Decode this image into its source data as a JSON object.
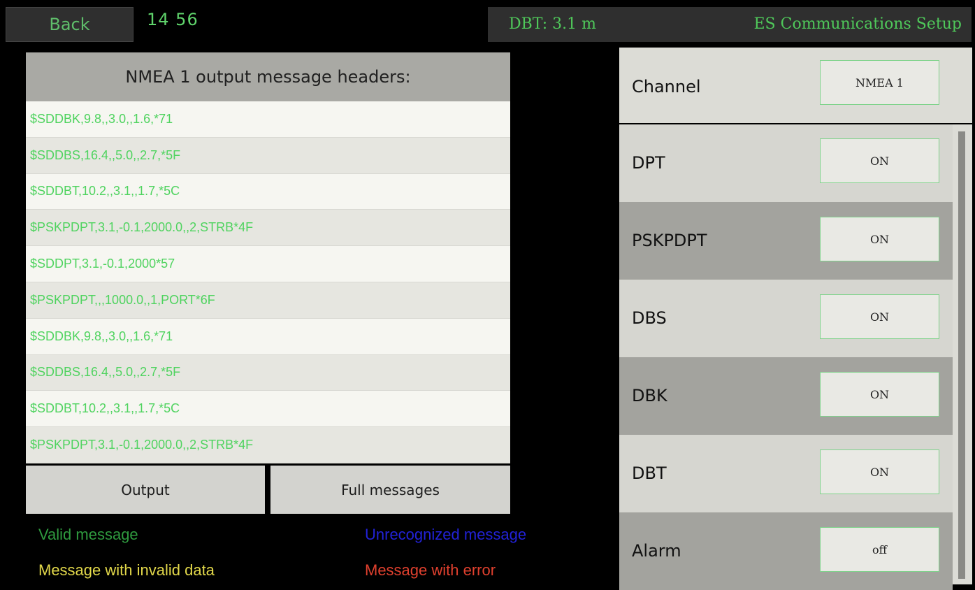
{
  "topbar": {
    "back_label": "Back",
    "clock": "14 56",
    "dbt": "DBT: 3.1 m",
    "title": "ES Communications Setup"
  },
  "messages": {
    "header": "NMEA 1 output message headers:",
    "rows": [
      "$SDDBK,9.8,,3.0,,1.6,*71",
      "$SDDBS,16.4,,5.0,,2.7,*5F",
      "$SDDBT,10.2,,3.1,,1.7,*5C",
      "$PSKPDPT,3.1,-0.1,2000.0,,2,STRB*4F",
      "$SDDPT,3.1,-0.1,2000*57",
      "$PSKPDPT,,,1000.0,,1,PORT*6F",
      "$SDDBK,9.8,,3.0,,1.6,*71",
      "$SDDBS,16.4,,5.0,,2.7,*5F",
      "$SDDBT,10.2,,3.1,,1.7,*5C",
      "$PSKPDPT,3.1,-0.1,2000.0,,2,STRB*4F"
    ],
    "output_label": "Output",
    "full_label": "Full messages"
  },
  "legend": {
    "valid": "Valid message",
    "unrecognized": "Unrecognized message",
    "invalid_data": "Message with invalid data",
    "error": "Message with error",
    "colors": {
      "valid": "#2f9b3f",
      "unrecognized": "#2222d8",
      "invalid_data": "#e2d84a",
      "error": "#e0402e"
    }
  },
  "settings": {
    "channel": {
      "label": "Channel",
      "value": "NMEA 1"
    },
    "options": [
      {
        "label": "DPT",
        "value": "ON"
      },
      {
        "label": "PSKPDPT",
        "value": "ON"
      },
      {
        "label": "DBS",
        "value": "ON"
      },
      {
        "label": "DBK",
        "value": "ON"
      },
      {
        "label": "DBT",
        "value": "ON"
      },
      {
        "label": "Alarm",
        "value": "off"
      }
    ]
  }
}
